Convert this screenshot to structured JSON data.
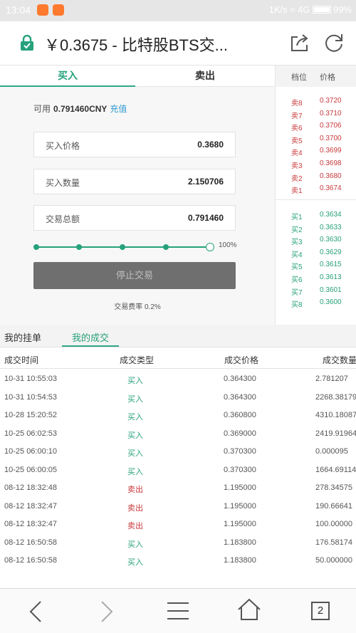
{
  "status_bar": {
    "time": "13:04",
    "network": "1K/s",
    "signal": "4G",
    "battery": "99%"
  },
  "page": {
    "title": "￥0.3675 - 比特股BTS交..."
  },
  "trade_tabs": {
    "buy": "买入",
    "sell": "卖出"
  },
  "form": {
    "available_label": "可用",
    "available_value": "0.791460CNY",
    "recharge": "充值",
    "price_label": "买入价格",
    "price_value": "0.3680",
    "amount_label": "买入数量",
    "amount_value": "2.150706",
    "total_label": "交易总额",
    "total_value": "0.791460",
    "slider_percent": "100%",
    "slider_fraction": 1.0,
    "stop_button": "停止交易",
    "fee": "交易费率 0.2%"
  },
  "order_book": {
    "headers": {
      "level": "档位",
      "price": "价格"
    },
    "sells": [
      {
        "level": "卖8",
        "price": "0.3720"
      },
      {
        "level": "卖7",
        "price": "0.3710"
      },
      {
        "level": "卖6",
        "price": "0.3706"
      },
      {
        "level": "卖5",
        "price": "0.3700"
      },
      {
        "level": "卖4",
        "price": "0.3699"
      },
      {
        "level": "卖3",
        "price": "0.3698"
      },
      {
        "level": "卖2",
        "price": "0.3680"
      },
      {
        "level": "卖1",
        "price": "0.3674"
      }
    ],
    "buys": [
      {
        "level": "买1",
        "price": "0.3634"
      },
      {
        "level": "买2",
        "price": "0.3633"
      },
      {
        "level": "买3",
        "price": "0.3630"
      },
      {
        "level": "买4",
        "price": "0.3629"
      },
      {
        "level": "买5",
        "price": "0.3615"
      },
      {
        "level": "买6",
        "price": "0.3613"
      },
      {
        "level": "买7",
        "price": "0.3601"
      },
      {
        "level": "买8",
        "price": "0.3600"
      }
    ]
  },
  "history": {
    "tabs": {
      "my_orders": "我的挂单",
      "my_trades": "我的成交"
    },
    "columns": {
      "time": "成交时间",
      "type": "成交类型",
      "price": "成交价格",
      "quantity": "成交数量"
    },
    "rows": [
      {
        "time": "10-31 10:55:03",
        "type": "买入",
        "side": "buy",
        "price": "0.364300",
        "quantity": "2.781207"
      },
      {
        "time": "10-31 10:54:53",
        "type": "买入",
        "side": "buy",
        "price": "0.364300",
        "quantity": "2268.38179"
      },
      {
        "time": "10-28 15:20:52",
        "type": "买入",
        "side": "buy",
        "price": "0.360800",
        "quantity": "4310.18087"
      },
      {
        "time": "10-25 06:02:53",
        "type": "买入",
        "side": "buy",
        "price": "0.369000",
        "quantity": "2419.91964"
      },
      {
        "time": "10-25 06:00:10",
        "type": "买入",
        "side": "buy",
        "price": "0.370300",
        "quantity": "0.000095"
      },
      {
        "time": "10-25 06:00:05",
        "type": "买入",
        "side": "buy",
        "price": "0.370300",
        "quantity": "1664.69114"
      },
      {
        "time": "08-12 18:32:48",
        "type": "卖出",
        "side": "sell",
        "price": "1.195000",
        "quantity": "278.34575"
      },
      {
        "time": "08-12 18:32:47",
        "type": "卖出",
        "side": "sell",
        "price": "1.195000",
        "quantity": "190.66641"
      },
      {
        "time": "08-12 18:32:47",
        "type": "卖出",
        "side": "sell",
        "price": "1.195000",
        "quantity": "100.00000"
      },
      {
        "time": "08-12 16:50:58",
        "type": "买入",
        "side": "buy",
        "price": "1.183800",
        "quantity": "176.58174"
      },
      {
        "time": "08-12 16:50:58",
        "type": "买入",
        "side": "buy",
        "price": "1.183800",
        "quantity": "50.000000"
      }
    ]
  },
  "nav": {
    "tab_count": "2"
  },
  "colors": {
    "accent": "#26a17b",
    "sell": "#c9393c",
    "button": "#6f6f6f",
    "link": "#2e9ad0"
  }
}
